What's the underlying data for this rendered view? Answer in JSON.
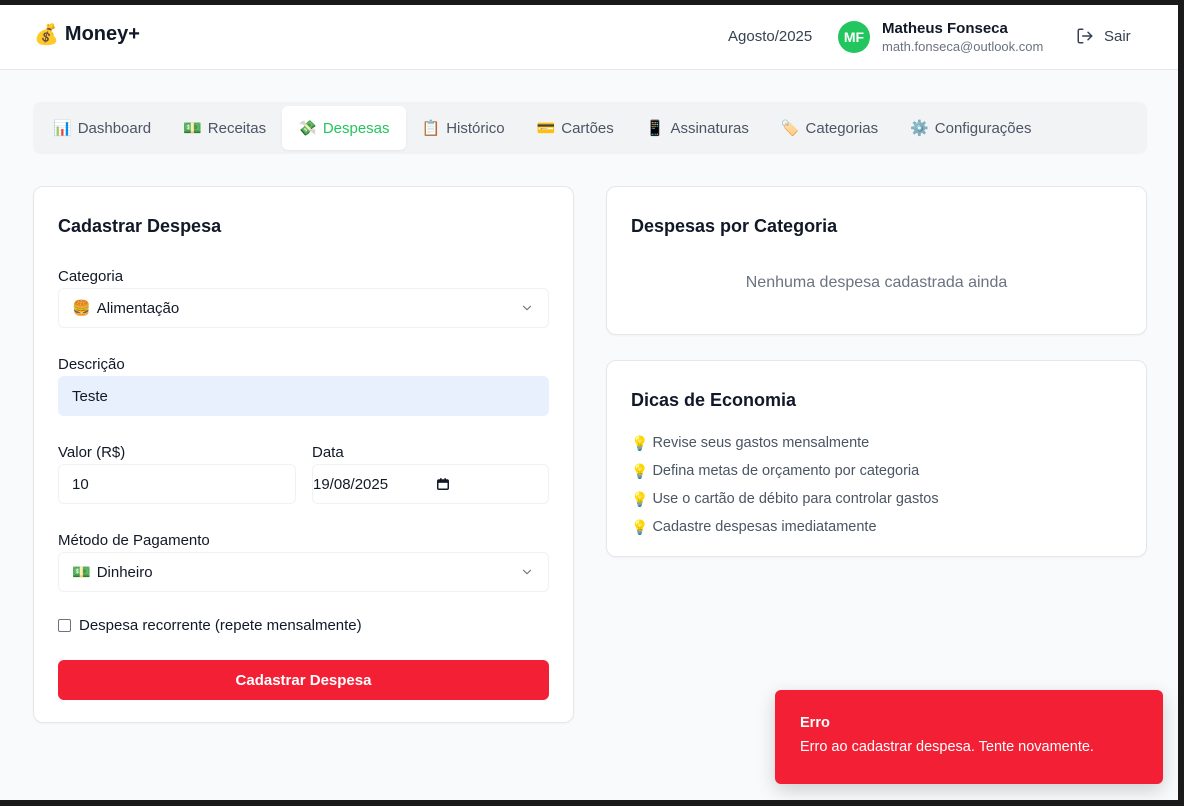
{
  "header": {
    "app_name": "Money+",
    "logo_icon": "💰",
    "period": "Agosto/2025",
    "user": {
      "initials": "MF",
      "name": "Matheus Fonseca",
      "email": "math.fonseca@outlook.com"
    },
    "logout_label": "Sair",
    "colors": {
      "avatar": "#22c55e"
    }
  },
  "tabs": [
    {
      "label": "Dashboard",
      "icon": "📊"
    },
    {
      "label": "Receitas",
      "icon": "💵"
    },
    {
      "label": "Despesas",
      "icon": "💸",
      "active": true
    },
    {
      "label": "Histórico",
      "icon": "📋"
    },
    {
      "label": "Cartões",
      "icon": "💳"
    },
    {
      "label": "Assinaturas",
      "icon": "📱"
    },
    {
      "label": "Categorias",
      "icon": "🏷️"
    },
    {
      "label": "Configurações",
      "icon": "⚙️"
    }
  ],
  "form": {
    "title": "Cadastrar Despesa",
    "category_label": "Categoria",
    "category_value": "Alimentação",
    "category_icon": "🍔",
    "description_label": "Descrição",
    "description_value": "Teste",
    "amount_label": "Valor (R$)",
    "amount_value": "10",
    "date_label": "Data",
    "date_value": "19/08/2025",
    "payment_label": "Método de Pagamento",
    "payment_value": "Dinheiro",
    "payment_icon": "💵",
    "recurring_label": "Despesa recorrente (repete mensalmente)",
    "recurring_checked": false,
    "submit_label": "Cadastrar Despesa",
    "colors": {
      "submit": "#f21f35"
    }
  },
  "category_card": {
    "title": "Despesas por Categoria",
    "empty_message": "Nenhuma despesa cadastrada ainda"
  },
  "tips_card": {
    "title": "Dicas de Economia",
    "items": [
      "Revise seus gastos mensalmente",
      "Defina metas de orçamento por categoria",
      "Use o cartão de débito para controlar gastos",
      "Cadastre despesas imediatamente"
    ]
  },
  "toast": {
    "title": "Erro",
    "message": "Erro ao cadastrar despesa. Tente novamente.",
    "color": "#f21f35"
  }
}
